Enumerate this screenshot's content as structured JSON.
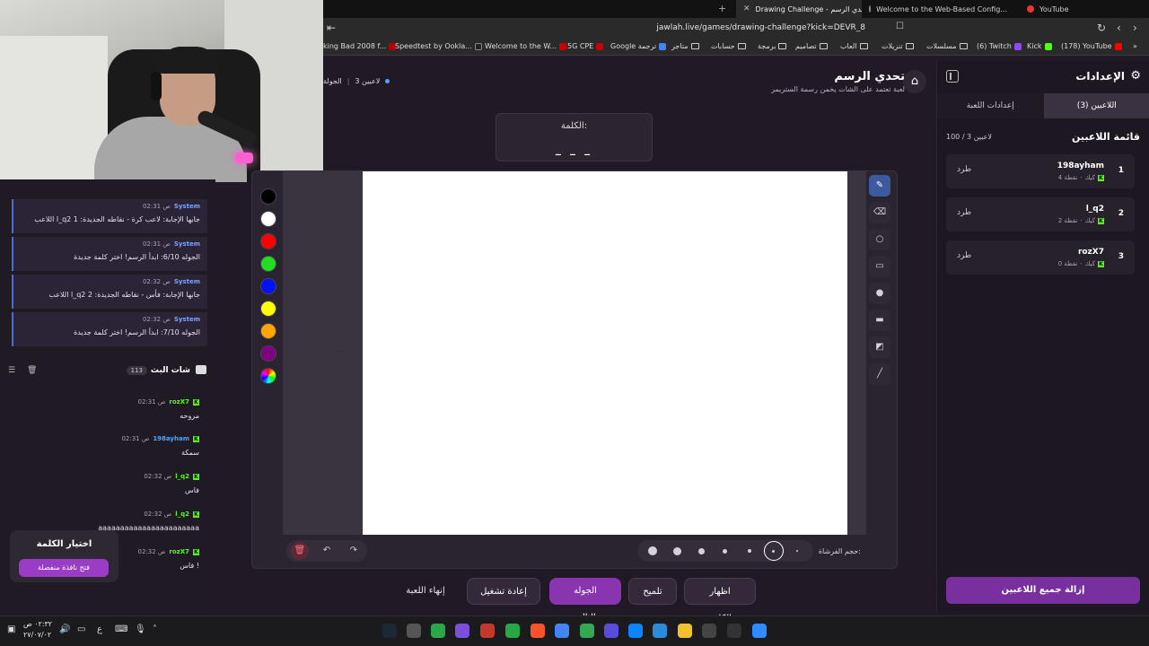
{
  "browser": {
    "tabs": [
      {
        "label": "Drawing Challenge - تحدي الرسم",
        "active": true
      },
      {
        "label": "Welcome to the Web-Based Config...",
        "active": false
      },
      {
        "label": "YouTube",
        "active": false
      }
    ],
    "new_tab": "+",
    "url": "jawlah.live/games/drawing-challenge?kick=DEVR_8",
    "bookmarks": [
      {
        "label": "king Bad 2008 f...",
        "color": "#b00"
      },
      {
        "label": "Speedtest by Ookla...",
        "color": "#222"
      },
      {
        "label": "Welcome to the W...",
        "color": "#c00"
      },
      {
        "label": "5G CPE",
        "color": "#c00"
      },
      {
        "label": "Google ترجمة",
        "color": "#4285f4"
      },
      {
        "label": "متاجر",
        "color": ""
      },
      {
        "label": "حسابات",
        "color": ""
      },
      {
        "label": "برمجة",
        "color": ""
      },
      {
        "label": "تصاميم",
        "color": ""
      },
      {
        "label": "العاب",
        "color": ""
      },
      {
        "label": "تنزيلات",
        "color": ""
      },
      {
        "label": "مسلسلات",
        "color": ""
      },
      {
        "label": "(6) Twitch",
        "color": "#9146ff"
      },
      {
        "label": "Kick",
        "color": "#53fc18"
      },
      {
        "label": "(178) YouTube",
        "color": "#f00"
      }
    ]
  },
  "settings": {
    "title": "الإعدادات",
    "tabs": [
      "اللاعبين (3)",
      "إعدادات اللعبة"
    ],
    "players_title": "قائمة اللاعبين",
    "players_count": "100 / 3 لاعبين",
    "players": [
      {
        "rank": "1",
        "name": "198ayham",
        "platform": "كيك",
        "points": "4 نقطة",
        "kick_label": "طرد"
      },
      {
        "rank": "2",
        "name": "l_q2",
        "platform": "كيك",
        "points": "2 نقطة",
        "kick_label": "طرد"
      },
      {
        "rank": "3",
        "name": "rozX7",
        "platform": "كيك",
        "points": "0 نقطة",
        "kick_label": "طرد"
      }
    ],
    "remove_all": "إزالة جميع اللاعبين"
  },
  "game": {
    "title": "تحدي الرسم",
    "subtitle": "لعبة تعتمد على الشات يخمن رسمة الستريمر",
    "round_label": "الجولة",
    "players_online": "3 لاعبين",
    "word_label": "الكلمة:",
    "word_blanks": "_ _ _",
    "palette": [
      "#000000",
      "#ffffff",
      "#ff0000",
      "#22dd22",
      "#0011ff",
      "#ffff00",
      "#ffa500",
      "#800080"
    ],
    "tools": [
      "pencil-icon",
      "eraser-icon",
      "circle-icon",
      "rectangle-icon",
      "filled-circle-icon",
      "filled-rect-icon",
      "fill-bucket-icon",
      "line-icon"
    ],
    "brush_label": "حجم الفرشاة:",
    "actions": {
      "show_word": "اظهار الكلمة",
      "hint": "تلميح",
      "next_round": "الجوله التالية",
      "restart": "إعادة تشغيل",
      "end_game": "إنهاء اللعبة"
    }
  },
  "system_messages": [
    {
      "sender": "System",
      "time": "02:31 ص",
      "text": "اللاعب l_q2 جابها الإجابة: لاعب كرة - نقاطه الجديدة: 1"
    },
    {
      "sender": "System",
      "time": "02:31 ص",
      "text": "الجوله 6/10: ابدأ الرسم! اختر كلمة جديدة"
    },
    {
      "sender": "System",
      "time": "02:32 ص",
      "text": "اللاعب l_q2 جابها الإجابة: فأس - نقاطه الجديدة: 2"
    },
    {
      "sender": "System",
      "time": "02:32 ص",
      "text": "الجوله 7/10: ابدأ الرسم! اختر كلمة جديدة"
    }
  ],
  "chat": {
    "title": "شات البث",
    "count": "113",
    "messages": [
      {
        "user": "rozX7",
        "time": "02:31 ص",
        "text": "مروحه",
        "color": "#53fc18"
      },
      {
        "user": "198ayham",
        "time": "02:31 ص",
        "text": "سمكة",
        "color": "#4ea3ff"
      },
      {
        "user": "l_q2",
        "time": "02:32 ص",
        "text": "فاس",
        "color": "#53fc18"
      },
      {
        "user": "l_q2",
        "time": "02:32 ص",
        "text": "aaaaaaaaaaaaaaaaaaaaaaa",
        "color": "#53fc18"
      },
      {
        "user": "rozX7",
        "time": "02:32 ص",
        "text": "فاس !",
        "color": "#53fc18"
      }
    ]
  },
  "pick_word": {
    "title": "اختيار الكلمة",
    "button": "فتح نافذة منفصلة"
  },
  "taskbar": {
    "time": "٠٢:٣٢ ص",
    "date": "٢٧/٠٧/٠٢",
    "lang": "ع"
  }
}
